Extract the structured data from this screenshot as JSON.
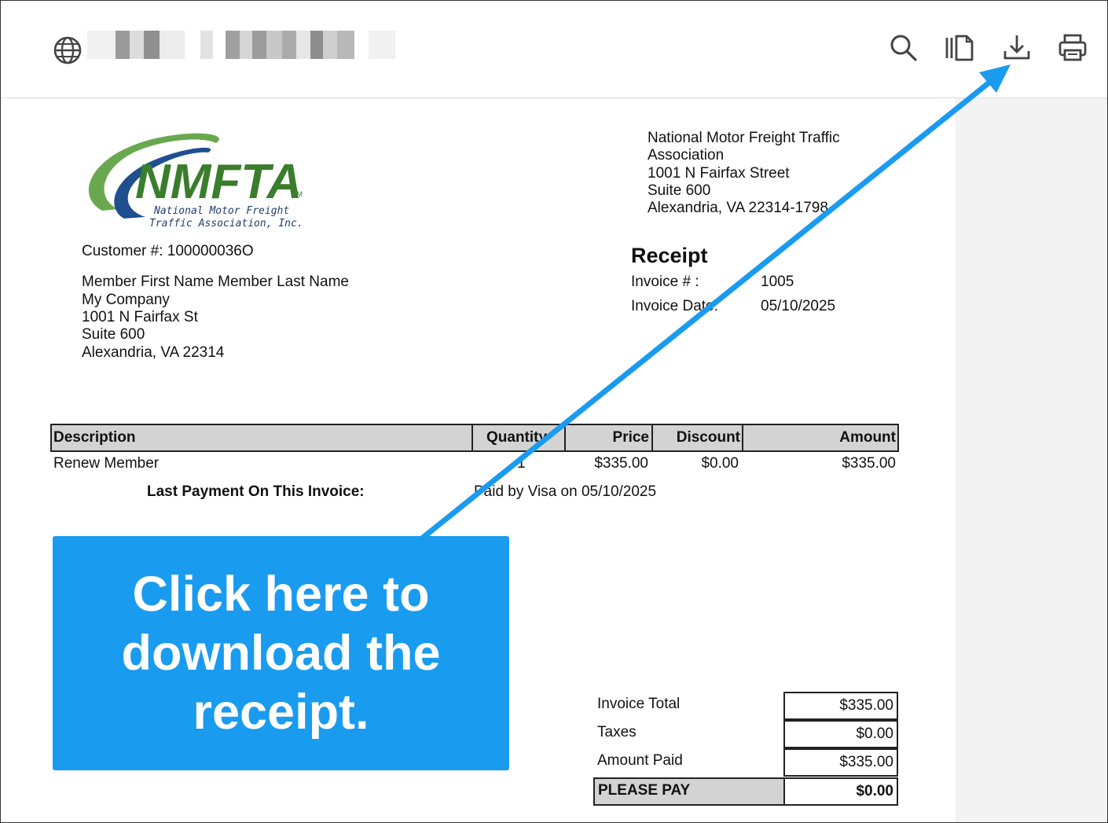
{
  "toolbar": {
    "icons": [
      "globe-icon",
      "search-icon",
      "page-view-icon",
      "download-icon",
      "print-icon"
    ]
  },
  "logo": {
    "wordmark": "NMFTA",
    "tm": "TM",
    "line1": "National Motor Freight",
    "line2": "Traffic Association, Inc."
  },
  "org_address": {
    "line1": "National Motor Freight Traffic",
    "line2": "Association",
    "line3": "1001 N Fairfax Street",
    "line4": "Suite 600",
    "line5": "Alexandria, VA 22314-1798"
  },
  "customer": {
    "number_label": "Customer #: 100000036O",
    "name": "Member First Name Member Last Name",
    "company": "My Company",
    "street": "1001 N Fairfax St",
    "suite": "Suite 600",
    "city": "Alexandria, VA  22314"
  },
  "receipt": {
    "title": "Receipt",
    "invoice_no_label": "Invoice # :",
    "invoice_no": "1005",
    "invoice_date_label": "Invoice Date:",
    "invoice_date": "05/10/2025"
  },
  "line_items": {
    "headers": {
      "description": "Description",
      "quantity": "Quantity",
      "price": "Price",
      "discount": "Discount",
      "amount": "Amount"
    },
    "rows": [
      {
        "description": "Renew Member",
        "quantity": "1",
        "price": "$335.00",
        "discount": "$0.00",
        "amount": "$335.00"
      }
    ]
  },
  "last_payment": {
    "label": "Last Payment On This Invoice:",
    "value": "Paid by Visa on 05/10/2025"
  },
  "totals": {
    "invoice_total_label": "Invoice Total",
    "invoice_total": "$335.00",
    "taxes_label": "Taxes",
    "taxes": "$0.00",
    "amount_paid_label": "Amount Paid",
    "amount_paid": "$335.00",
    "please_pay_label": "PLEASE PAY",
    "please_pay": "$0.00"
  },
  "callout": {
    "text": "Click here to download the receipt.",
    "color": "#199bef"
  }
}
